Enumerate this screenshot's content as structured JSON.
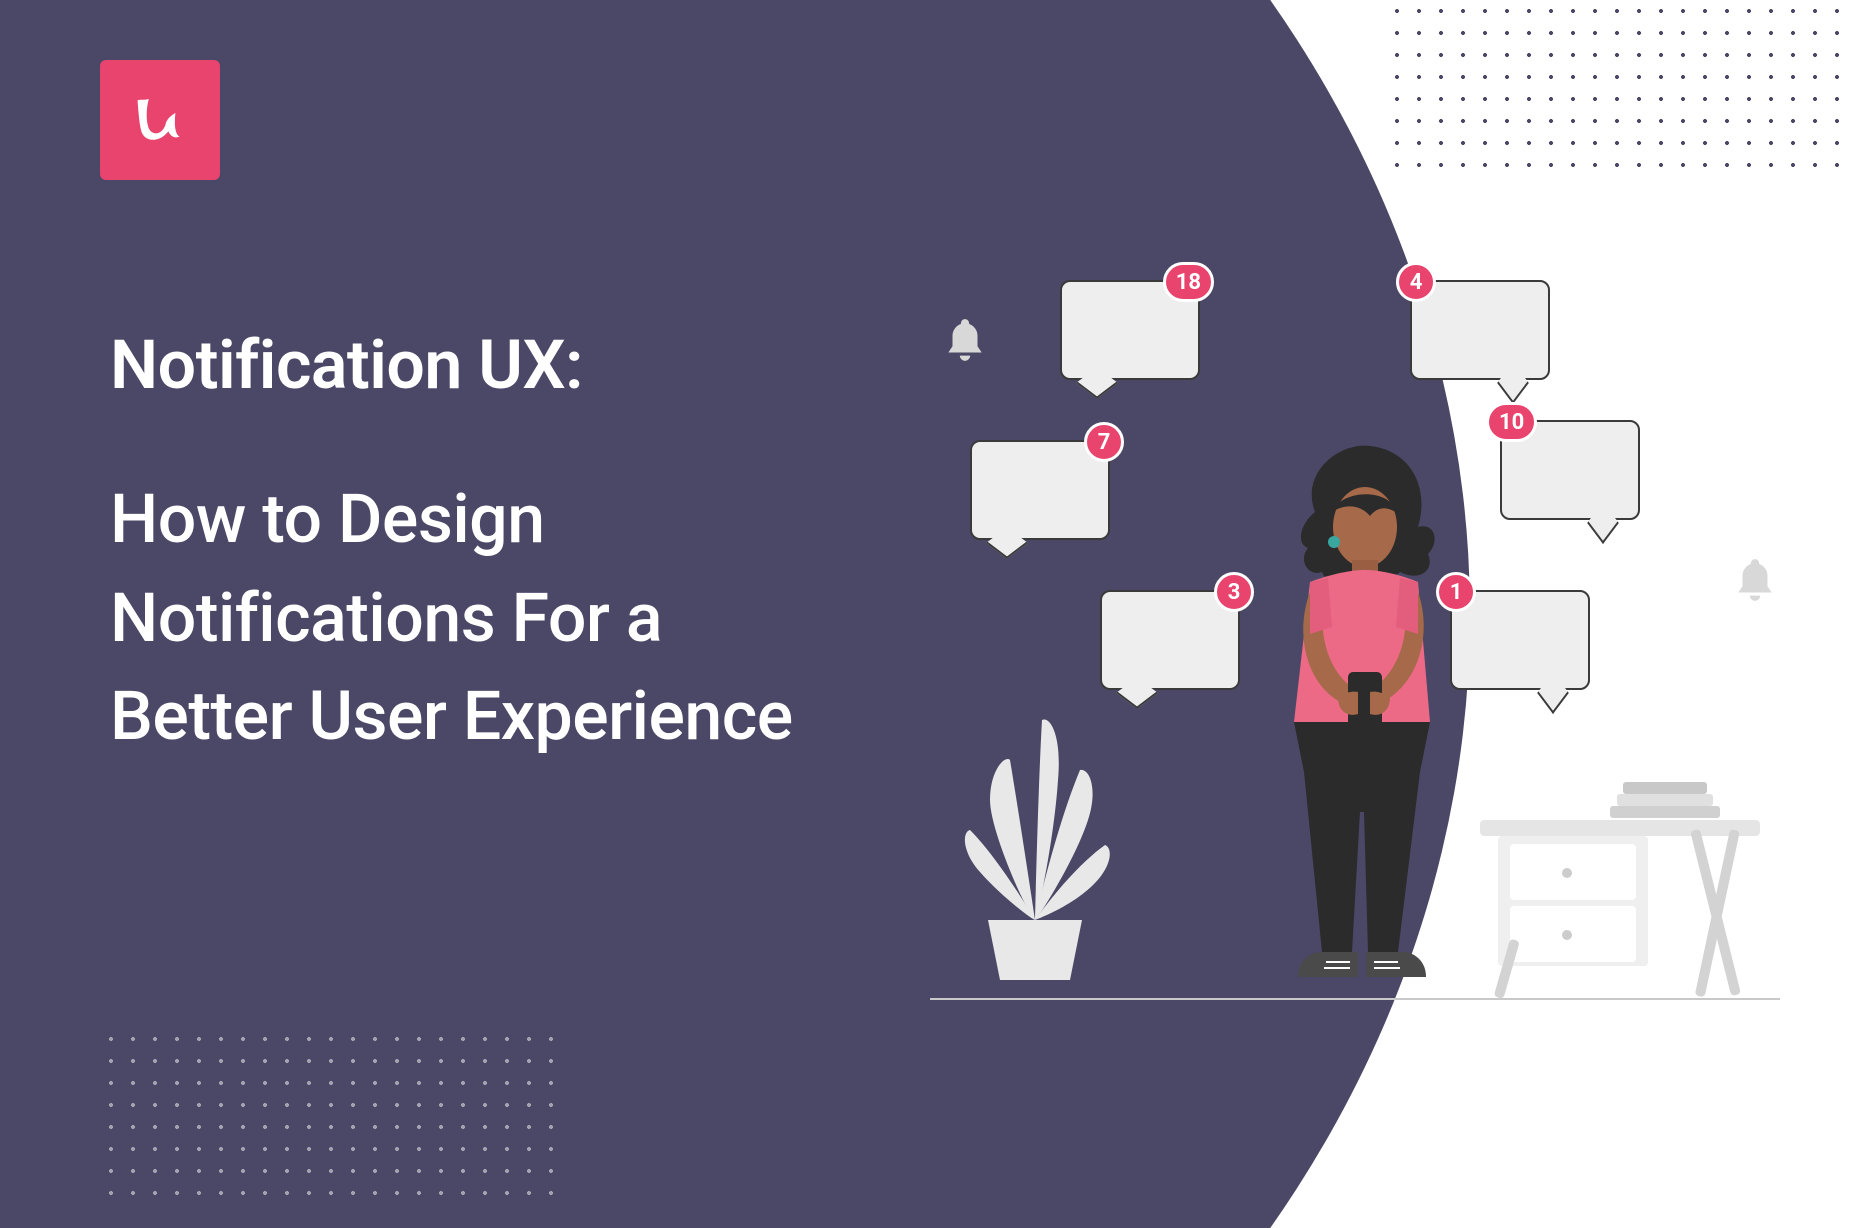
{
  "logo": {
    "letter": "u"
  },
  "heading": {
    "title": "Notification UX:",
    "subtitle": "How to Design Notifications For a Better User Experience"
  },
  "illustration": {
    "badges": {
      "b1": "18",
      "b2": "4",
      "b3": "7",
      "b4": "10",
      "b5": "3",
      "b6": "1"
    }
  },
  "colors": {
    "purple": "#4a4866",
    "accent": "#e8446d",
    "text": "#ffffff"
  }
}
